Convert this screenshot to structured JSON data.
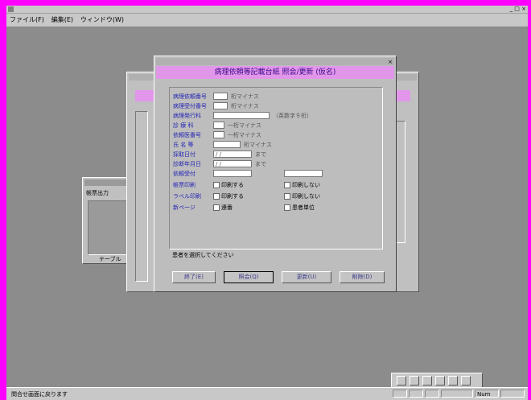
{
  "app": {
    "title": "",
    "window_controls": "_ □ ×"
  },
  "menu": {
    "items": [
      "ファイル(F)",
      "編集(E)",
      "ウィンドウ(W)"
    ]
  },
  "dialog": {
    "title": "",
    "heading": "病理依頼等記載台紙 照会/更新 (仮名)",
    "fields": [
      {
        "label": "病理依頼番号",
        "value": "",
        "unit": "桁マイナス"
      },
      {
        "label": "病理受付番号",
        "value": "",
        "unit": "桁マイナス"
      },
      {
        "label": "病理発行科",
        "value": "",
        "unit": "（英数字９桁）"
      },
      {
        "label": "診 療 科",
        "value": "",
        "unit": "一桁マイナス"
      },
      {
        "label": "依頼医番号",
        "value": "",
        "unit": "一桁マイナス"
      },
      {
        "label": "氏 名 等",
        "value": "",
        "unit": "桁マイナス"
      },
      {
        "label": "採取日付",
        "value": "/ /",
        "unit": "まで"
      },
      {
        "label": "診断年月日",
        "value": "/ /",
        "unit": "まで"
      },
      {
        "label": "依頼受付",
        "value": "",
        "unit": ""
      },
      {
        "label": "帳票印刷",
        "value": "印刷する",
        "unit": "印刷しない"
      },
      {
        "label": "ラベル印刷",
        "value": "印刷する",
        "unit": "印刷しない"
      },
      {
        "label": "新ページ",
        "value": "連番",
        "unit": "患者単位"
      }
    ],
    "note": "患者を選択してください",
    "buttons": [
      "終了(E)",
      "照会(Q)",
      "更新(U)",
      "削除(D)"
    ]
  },
  "side_window": {
    "title": "帳票出力",
    "label": "テーブル"
  },
  "status": {
    "text": "問合せ画面に戻ります",
    "cells": [
      "",
      "",
      "",
      "",
      "Num",
      ""
    ]
  },
  "colors": {
    "banner": "#e296ea",
    "banner_text": "#3a0a8a",
    "label": "#2727b5",
    "workspace": "#8c8c8c",
    "frame": "#ff00ff"
  }
}
